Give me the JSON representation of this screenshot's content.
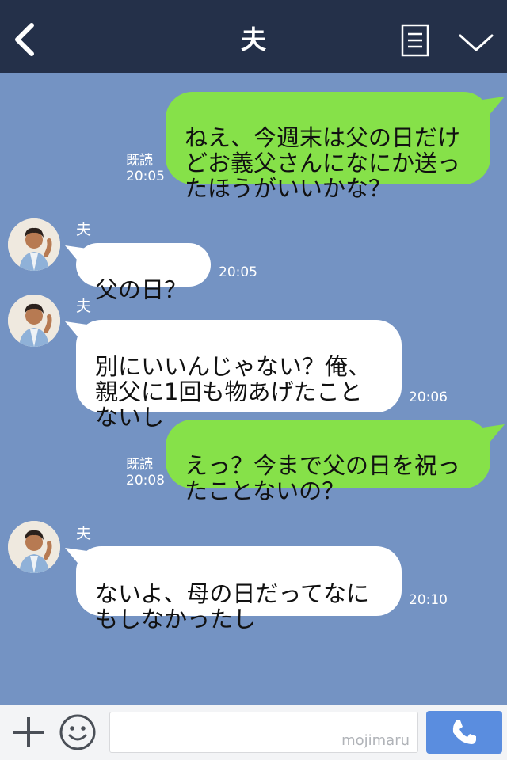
{
  "header": {
    "title": "夫"
  },
  "messages": [
    {
      "text": "ねえ、今週末は父の日だけ\nどお義父さんになにか送っ\nたほうがいいかな？",
      "read": "既読",
      "time": "20:05"
    },
    {
      "sender": "夫",
      "text": "父の日？",
      "time": "20:05"
    },
    {
      "sender": "夫",
      "text": "別にいいんじゃない？俺、\n親父に1回も物あげたこと\nないし",
      "time": "20:06"
    },
    {
      "text": "えっ？今まで父の日を祝っ\nたことないの？",
      "read": "既読",
      "time": "20:08"
    },
    {
      "sender": "夫",
      "text": "ないよ、母の日だってなに\nもしなかったし",
      "time": "20:10"
    }
  ],
  "input": {
    "value": "",
    "watermark": "mojimaru"
  },
  "colors": {
    "header": "#243049",
    "background": "#7493c3",
    "outgoing_bubble": "#86e149",
    "incoming_bubble": "#ffffff",
    "call_button": "#5a8ddf"
  },
  "icons": {
    "back": "chevron-left-icon",
    "note": "note-icon",
    "menu": "chevron-down-icon",
    "add": "plus-icon",
    "sticker": "smile-icon",
    "call": "phone-icon"
  }
}
